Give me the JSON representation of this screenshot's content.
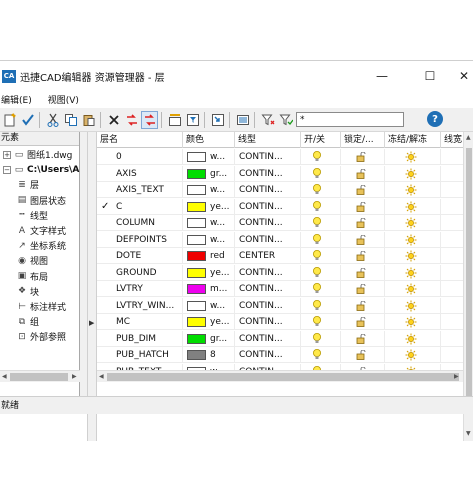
{
  "window": {
    "title": "迅捷CAD编辑器 资源管理器 - 层",
    "app_icon": "CA",
    "minimize_glyph": "—",
    "maximize_glyph": "☐",
    "close_glyph": "✕"
  },
  "menu": {
    "items": [
      "编辑(E)",
      "视图(V)"
    ]
  },
  "toolbar": {
    "filter_value": "*",
    "help_glyph": "?"
  },
  "left_panel": {
    "header": "元素",
    "tree": [
      {
        "label": "图纸1.dwg",
        "expander": "+",
        "icon": "drawing-file-icon",
        "glyph": "▭",
        "bold": false
      },
      {
        "label": "C:\\Users\\A",
        "expander": "−",
        "icon": "drawing-file-icon",
        "glyph": "▭",
        "bold": true
      },
      {
        "label": "层",
        "icon": "layers-icon",
        "glyph": "≣"
      },
      {
        "label": "图层状态",
        "icon": "layer-state-icon",
        "glyph": "▤"
      },
      {
        "label": "线型",
        "icon": "linetype-icon",
        "glyph": "┅"
      },
      {
        "label": "文字样式",
        "icon": "text-style-icon",
        "glyph": "A"
      },
      {
        "label": "坐标系统",
        "icon": "ucs-icon",
        "glyph": "↗"
      },
      {
        "label": "视图",
        "icon": "view-eye-icon",
        "glyph": "◉"
      },
      {
        "label": "布局",
        "icon": "layout-icon",
        "glyph": "▣"
      },
      {
        "label": "块",
        "icon": "block-icon",
        "glyph": "❖"
      },
      {
        "label": "标注样式",
        "icon": "dimension-style-icon",
        "glyph": "⊢"
      },
      {
        "label": "组",
        "icon": "group-icon",
        "glyph": "⧉"
      },
      {
        "label": "外部参照",
        "icon": "xref-icon",
        "glyph": "⊡"
      }
    ]
  },
  "grid": {
    "columns": [
      "层名",
      "颜色",
      "线型",
      "开/关",
      "锁定/...",
      "冻结/解冻",
      "线宽"
    ],
    "rows": [
      {
        "name": "0",
        "color_hex": "#ffffff",
        "color_text": "w...",
        "linetype": "CONTIN...",
        "current": false
      },
      {
        "name": "AXIS",
        "color_hex": "#00dd00",
        "color_text": "gr...",
        "linetype": "CONTIN...",
        "current": false
      },
      {
        "name": "AXIS_TEXT",
        "color_hex": "#ffffff",
        "color_text": "w...",
        "linetype": "CONTIN...",
        "current": false
      },
      {
        "name": "C",
        "color_hex": "#ffff00",
        "color_text": "ye...",
        "linetype": "CONTIN...",
        "current": true
      },
      {
        "name": "COLUMN",
        "color_hex": "#ffffff",
        "color_text": "w...",
        "linetype": "CONTIN...",
        "current": false
      },
      {
        "name": "DEFPOINTS",
        "color_hex": "#ffffff",
        "color_text": "w...",
        "linetype": "CONTIN...",
        "current": false
      },
      {
        "name": "DOTE",
        "color_hex": "#ee0000",
        "color_text": "red",
        "linetype": "CENTER",
        "current": false
      },
      {
        "name": "GROUND",
        "color_hex": "#ffff00",
        "color_text": "ye...",
        "linetype": "CONTIN...",
        "current": false
      },
      {
        "name": "LVTRY",
        "color_hex": "#ee00ee",
        "color_text": "m...",
        "linetype": "CONTIN...",
        "current": false
      },
      {
        "name": "LVTRY_WIN...",
        "color_hex": "#ffffff",
        "color_text": "w...",
        "linetype": "CONTIN...",
        "current": false
      },
      {
        "name": "MC",
        "color_hex": "#ffff00",
        "color_text": "ye...",
        "linetype": "CONTIN...",
        "current": false
      },
      {
        "name": "PUB_DIM",
        "color_hex": "#00dd00",
        "color_text": "gr...",
        "linetype": "CONTIN...",
        "current": false
      },
      {
        "name": "PUB_HATCH",
        "color_hex": "#808080",
        "color_text": "8",
        "linetype": "CONTIN...",
        "current": false
      },
      {
        "name": "PUB_TEXT",
        "color_hex": "#ffffff",
        "color_text": "w...",
        "linetype": "CONTIN...",
        "current": false
      }
    ],
    "current_mark": "✓"
  },
  "status": {
    "text": "就绪"
  }
}
